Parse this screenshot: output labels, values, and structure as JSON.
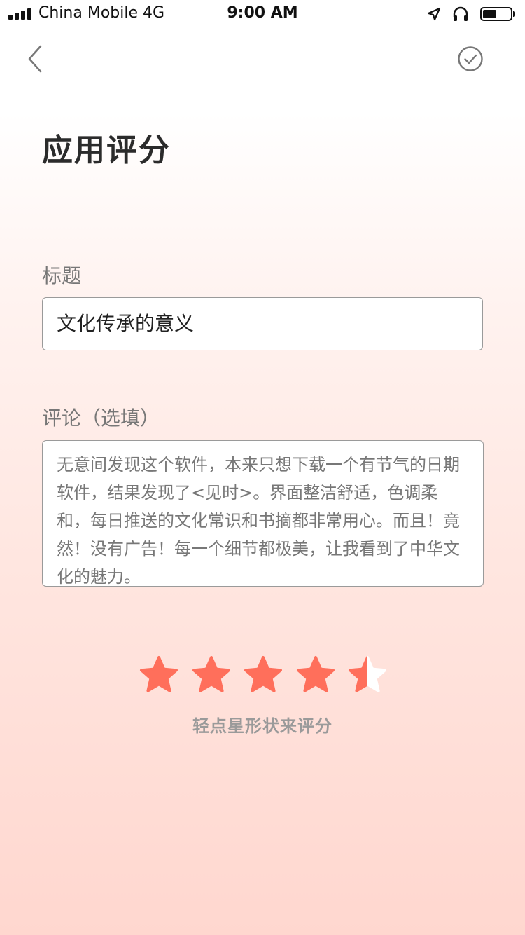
{
  "status_bar": {
    "carrier": "China Mobile  4G",
    "time": "9:00 AM"
  },
  "header": {
    "title": "应用评分"
  },
  "form": {
    "title_label": "标题",
    "title_value": "文化传承的意义",
    "comment_label": "评论（选填）",
    "comment_value": "无意间发现这个软件，本来只想下载一个有节气的日期软件，结果发现了<见时>。界面整洁舒适，色调柔和，每日推送的文化常识和书摘都非常用心。而且！竟然！没有广告！每一个细节都极美，让我看到了中华文化的魅力。"
  },
  "rating": {
    "value": 4.5,
    "max": 5,
    "hint": "轻点星形状来评分",
    "star_color": "#ff6f5b",
    "empty_color": "#ffffff"
  },
  "icons": {
    "back": "chevron-left-icon",
    "confirm": "check-circle-icon"
  }
}
